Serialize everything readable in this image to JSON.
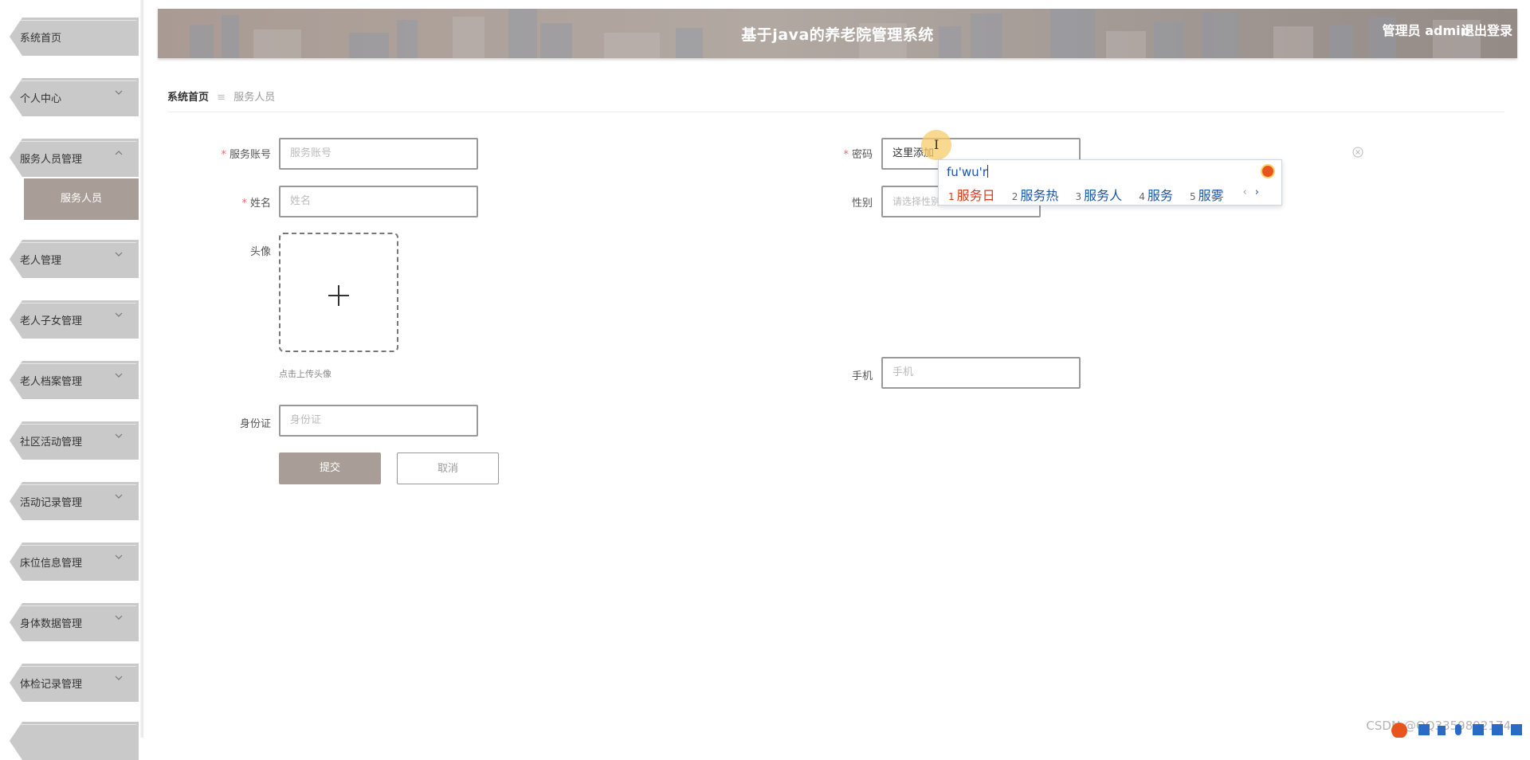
{
  "header": {
    "title": "基于java的养老院管理系统",
    "user": "管理员 admin",
    "logout": "退出登录"
  },
  "sidebar": {
    "items": [
      {
        "label": "系统首页"
      },
      {
        "label": "个人中心"
      },
      {
        "label": "服务人员管理"
      },
      {
        "label": "老人管理"
      },
      {
        "label": "老人子女管理"
      },
      {
        "label": "老人档案管理"
      },
      {
        "label": "社区活动管理"
      },
      {
        "label": "活动记录管理"
      },
      {
        "label": "床位信息管理"
      },
      {
        "label": "身体数据管理"
      },
      {
        "label": "体检记录管理"
      }
    ],
    "sub_item": "服务人员"
  },
  "breadcrumb": {
    "home": "系统首页",
    "separator": "≡",
    "current": "服务人员"
  },
  "form": {
    "account": {
      "label": "服务账号",
      "placeholder": "服务账号"
    },
    "password": {
      "label": "密码",
      "value": "这里添加"
    },
    "name": {
      "label": "姓名",
      "placeholder": "姓名"
    },
    "gender": {
      "label": "性别",
      "placeholder": "请选择性别"
    },
    "avatar": {
      "label": "头像",
      "tip": "点击上传头像"
    },
    "phone": {
      "label": "手机",
      "placeholder": "手机"
    },
    "id_card": {
      "label": "身份证",
      "placeholder": "身份证"
    },
    "submit": "提交",
    "cancel": "取消"
  },
  "ime": {
    "pinyin": "fu'wu'r",
    "candidates": [
      {
        "n": "1",
        "text": "服务日"
      },
      {
        "n": "2",
        "text": "服务热"
      },
      {
        "n": "3",
        "text": "服务人"
      },
      {
        "n": "4",
        "text": "服务"
      },
      {
        "n": "5",
        "text": "服雾"
      }
    ],
    "prev": "‹",
    "next": "›"
  },
  "watermark": "CSDN @QQ3359892174",
  "colors": {
    "accent": "#a99e97",
    "menu": "#c9c9c9",
    "required": "#ee6666"
  }
}
